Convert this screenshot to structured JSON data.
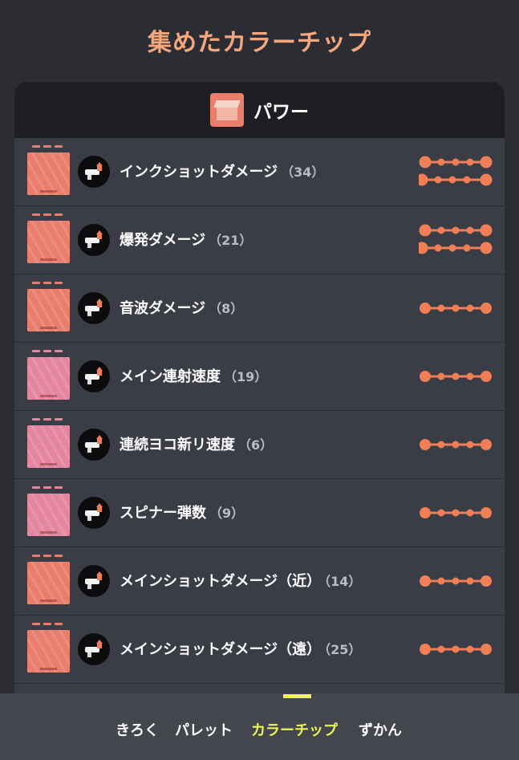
{
  "page": {
    "title": "集めたカラーチップ"
  },
  "panel": {
    "category_title": "パワー",
    "category_icon": "house-ink-icon"
  },
  "colors": {
    "accent": "#f07f58",
    "chip_salmon": "#e97e6d",
    "chip_pink": "#e586a0",
    "nav_active": "#eef55b",
    "title_color": "#f4a77d"
  },
  "abilities": [
    {
      "name": "インクショットダメージ",
      "count": "（34）",
      "chip": "salmon",
      "icon": "ink-shot-damage-icon",
      "progress": {
        "top_filled": 4,
        "bottom_filled": 4
      }
    },
    {
      "name": "爆発ダメージ",
      "count": "（21）",
      "chip": "salmon",
      "icon": "explosion-damage-icon",
      "progress": {
        "top_filled": 4,
        "bottom_filled": 3
      }
    },
    {
      "name": "音波ダメージ",
      "count": "（8）",
      "chip": "salmon",
      "icon": "sound-wave-damage-icon",
      "progress": {
        "top_filled": 4
      }
    },
    {
      "name": "メイン連射速度",
      "count": "（19）",
      "chip": "pink",
      "icon": "main-fire-rate-icon",
      "progress": {
        "top_filled": 4
      }
    },
    {
      "name": "連続ヨコ新リ速度",
      "count": "（6）",
      "chip": "pink",
      "icon": "horizontal-slash-speed-icon",
      "progress": {
        "top_filled": 4
      }
    },
    {
      "name": "スピナー弾数",
      "count": "（9）",
      "chip": "pink",
      "icon": "spinner-ammo-icon",
      "progress": {
        "top_filled": 4
      }
    },
    {
      "name": "メインショットダメージ（近）",
      "count": "（14）",
      "chip": "salmon",
      "icon": "main-shot-damage-near-icon",
      "progress": {
        "top_filled": 4
      }
    },
    {
      "name": "メインショットダメージ（遠）",
      "count": "（25）",
      "chip": "salmon",
      "icon": "main-shot-damage-far-icon",
      "progress": {
        "top_filled": 4
      }
    }
  ],
  "nav": {
    "items": [
      "きろく",
      "パレット",
      "カラーチップ",
      "ずかん"
    ],
    "active_index": 2
  }
}
